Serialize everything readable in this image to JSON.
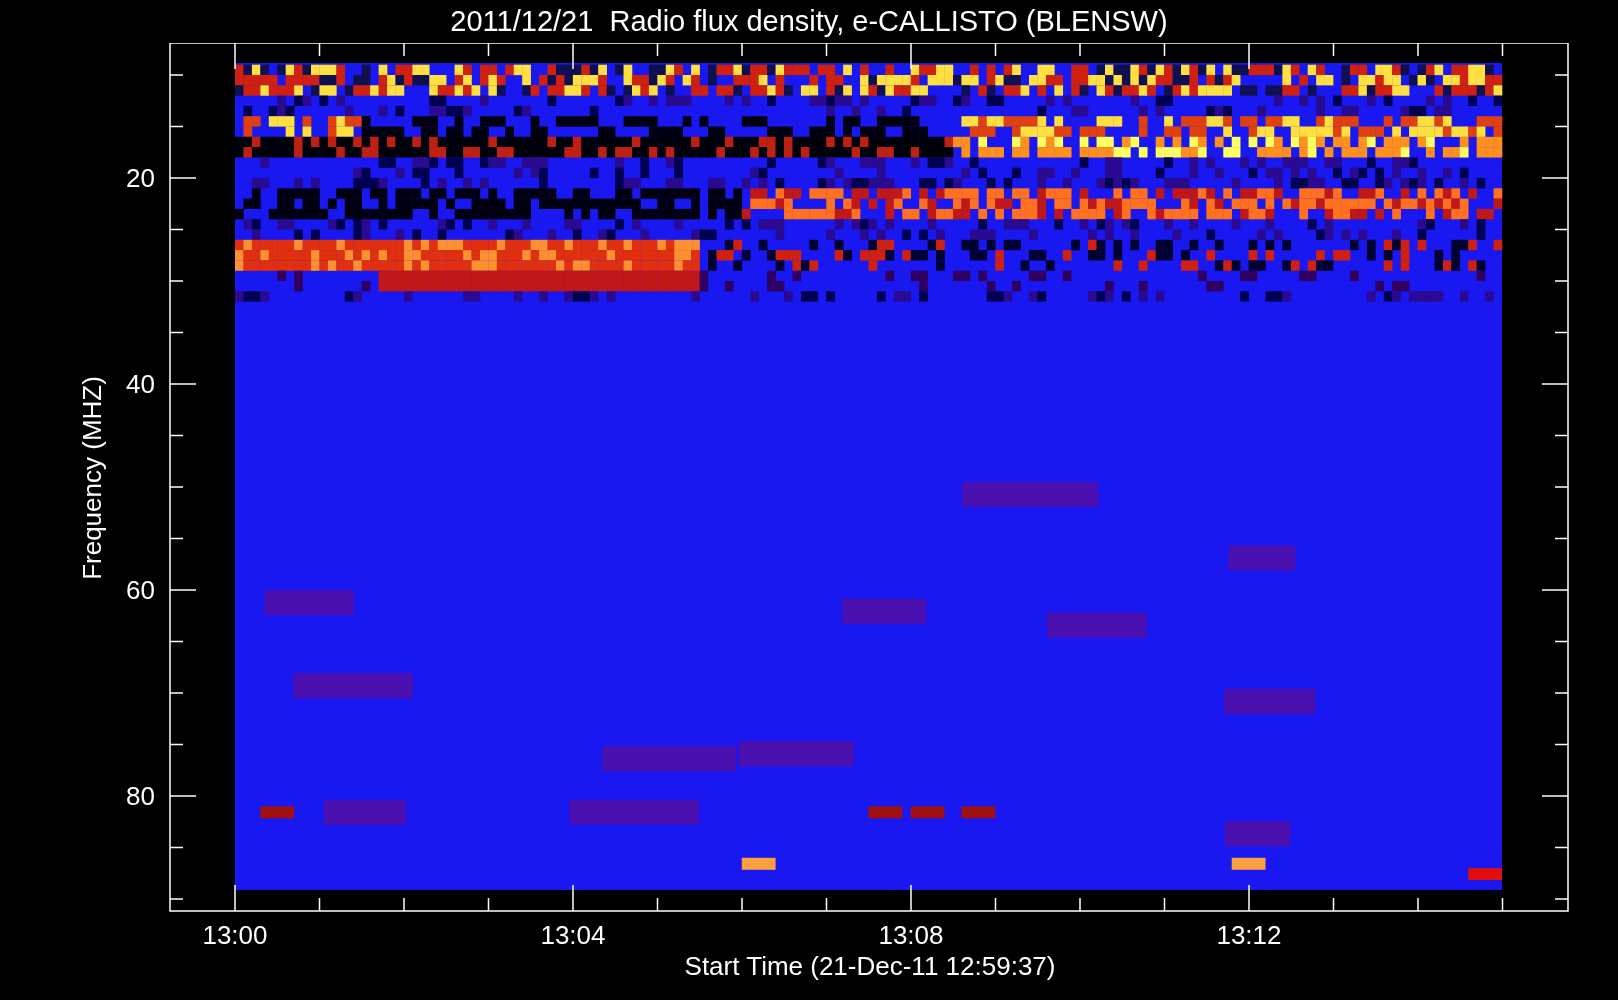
{
  "title": "2011/12/21  Radio flux density, e-CALLISTO (BLENSW)",
  "y_axis": {
    "label": "Frequency (MHZ)",
    "ticks": [
      "20",
      "40",
      "60",
      "80"
    ]
  },
  "x_axis": {
    "label": "Start Time (21-Dec-11 12:59:37)",
    "ticks": [
      "13:00",
      "13:04",
      "13:08",
      "13:12"
    ]
  }
}
